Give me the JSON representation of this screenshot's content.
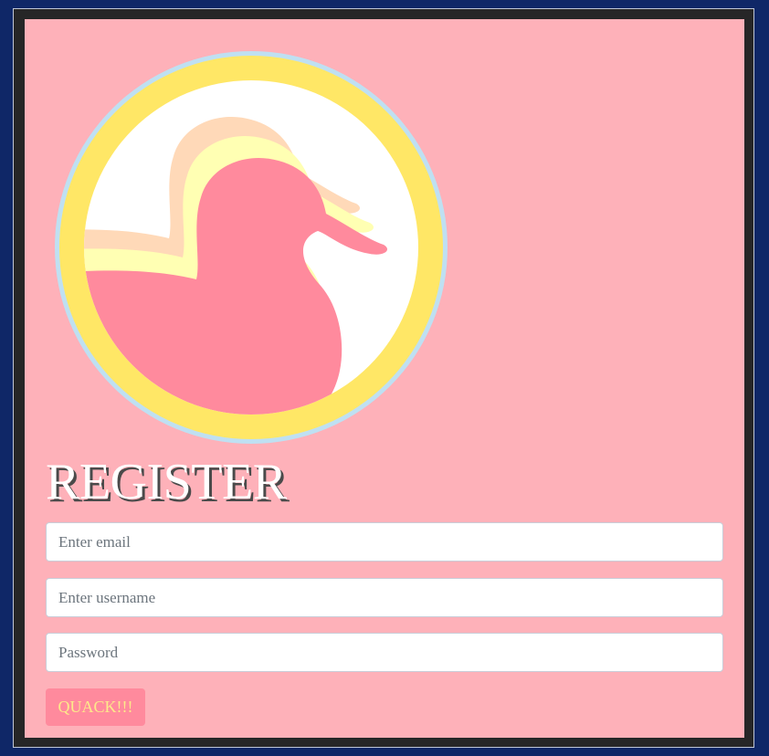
{
  "register_form": {
    "title": "REGISTER",
    "email_placeholder": "Enter email",
    "username_placeholder": "Enter username",
    "password_placeholder": "Password",
    "submit_label": "QUACK!!!"
  },
  "logo": {
    "icon": "duck-logo-icon",
    "colors": {
      "outer_ring": "#bfe0f2",
      "ring": "#ffe766",
      "background": "#ffffff",
      "duck_front": "#ff8a9d",
      "duck_middle": "#ffffb3",
      "duck_back": "#ffd9b8"
    }
  },
  "colors": {
    "page_background": "#0f2767",
    "frame": "#262627",
    "panel": "#feb1b9",
    "title_text": "#ffffff",
    "button_background": "#ff8a9d",
    "button_text": "#fde98a"
  }
}
